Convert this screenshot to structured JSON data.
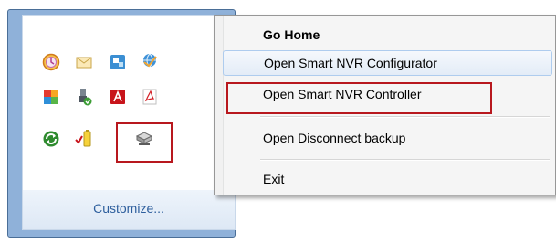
{
  "tray": {
    "customize_label": "Customize...",
    "icons": [
      {
        "name": "clock-shield-icon"
      },
      {
        "name": "mail-icon"
      },
      {
        "name": "network-display-icon"
      },
      {
        "name": "globe-app-icon"
      },
      {
        "name": "multicolor-app-icon"
      },
      {
        "name": "usb-device-icon"
      },
      {
        "name": "adobe-icon"
      },
      {
        "name": "pdf-icon"
      },
      {
        "name": "green-sync-icon"
      },
      {
        "name": "battery-check-icon"
      },
      {
        "name": "smart-nvr-device-icon"
      }
    ],
    "colors": {
      "highlight": "#b8181e",
      "link": "#2d5e9d",
      "frame": "#8fb1d9"
    }
  },
  "menu": {
    "items": [
      {
        "label": "Go Home"
      },
      {
        "label": "Open Smart NVR Configurator"
      },
      {
        "label": "Open Smart NVR Controller"
      },
      {
        "label": "Open Disconnect backup"
      },
      {
        "label": "Exit"
      }
    ]
  }
}
